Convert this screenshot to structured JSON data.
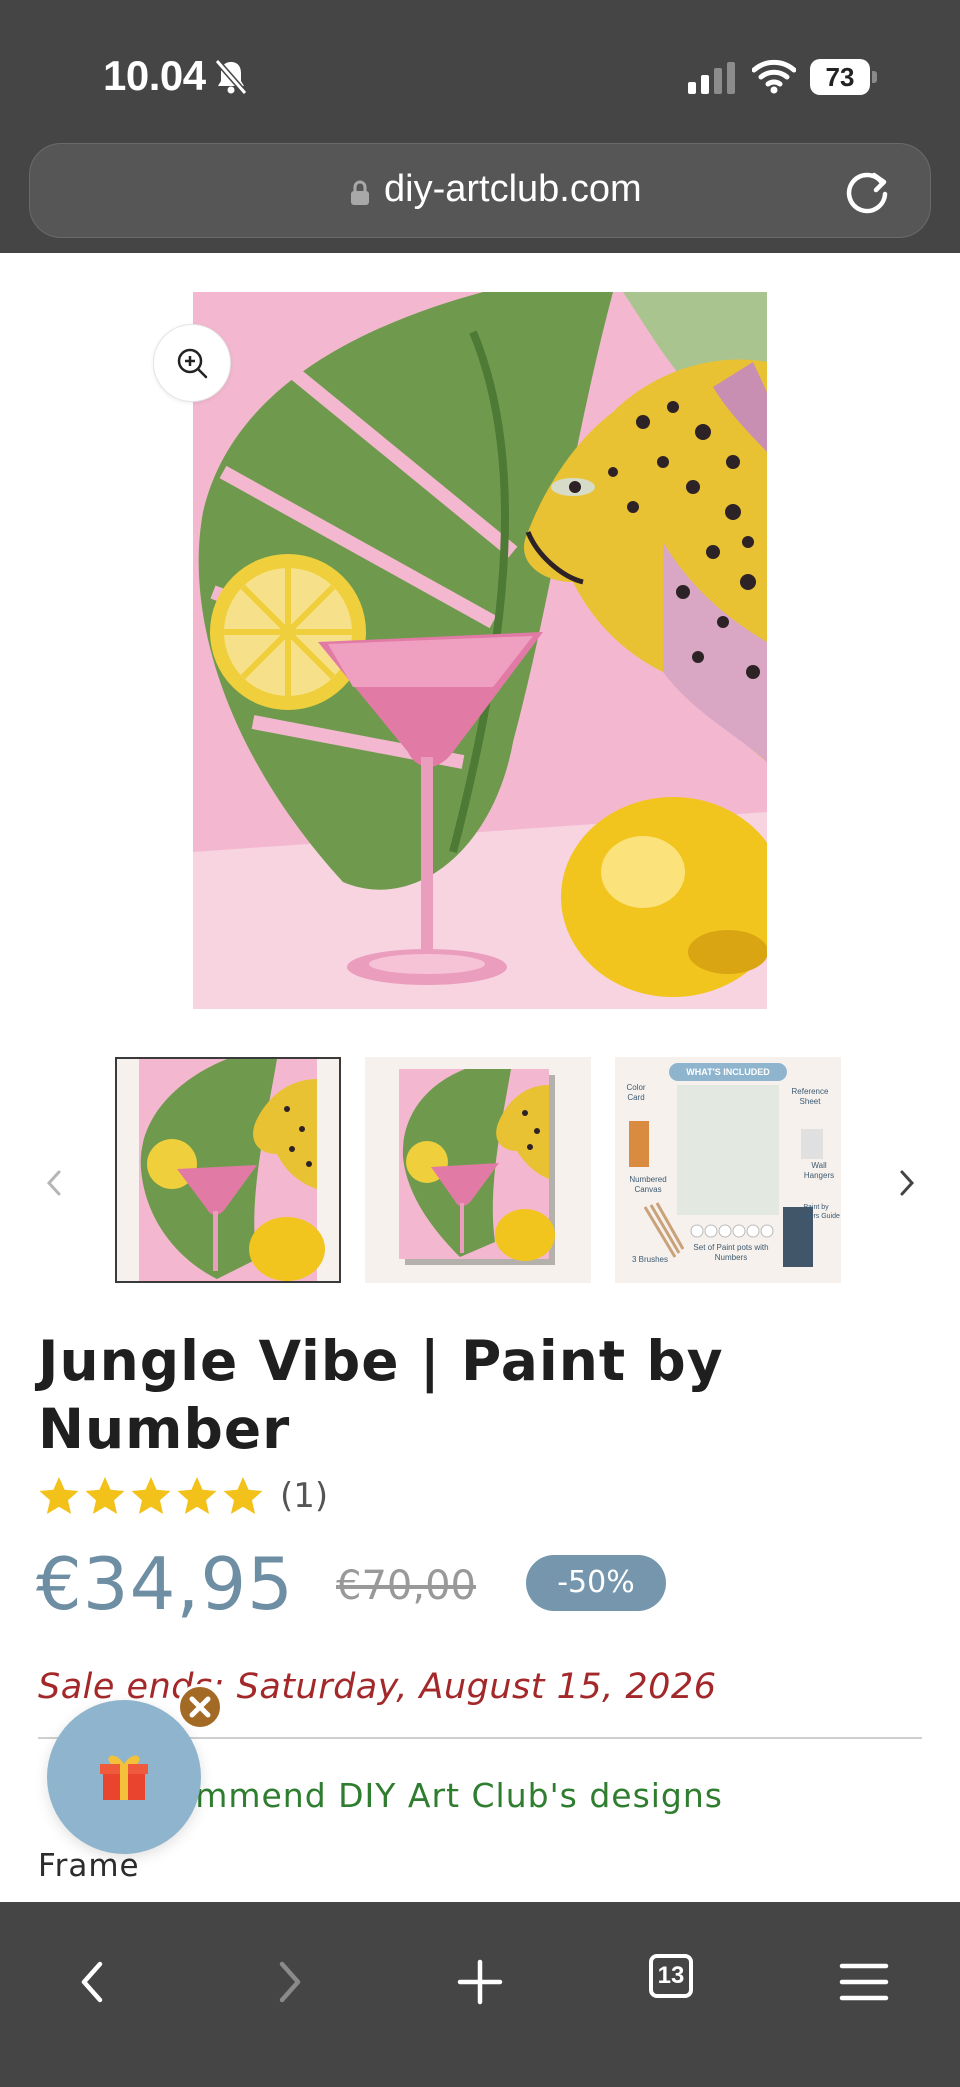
{
  "status_bar": {
    "time": "10.04",
    "battery": "73"
  },
  "url_bar": {
    "url": "diy-artclub.com"
  },
  "gallery": {
    "main_image_alt": "Jungle Vibe painting",
    "thumbnails": [
      {
        "label": ""
      },
      {
        "label": ""
      },
      {
        "label": "WHAT'S INCLUDED",
        "items": [
          "Color Card",
          "Reference Sheet",
          "Wall Hangers",
          "Numbered Canvas",
          "Paint by numbers Guide",
          "3 Brushes",
          "Set of Paint pots with Numbers"
        ]
      }
    ]
  },
  "product": {
    "title": "Jungle Vibe | Paint by Number",
    "rating": 5,
    "review_count": "(1)",
    "price": "€34,95",
    "old_price": "€70,00",
    "discount": "-50%",
    "sale_ends": "Sale ends: Saturday, August 15, 2026",
    "recommend": "ommend DIY Art Club's designs",
    "frame_label": "Frame"
  },
  "bottom_toolbar": {
    "tabs_count": "13"
  },
  "colors": {
    "price": "#6d8ea3",
    "badge": "#7596ad",
    "sale": "#a3282a",
    "recommend": "#2f7d2f",
    "star": "#f2c21a",
    "chrome": "#454545"
  }
}
